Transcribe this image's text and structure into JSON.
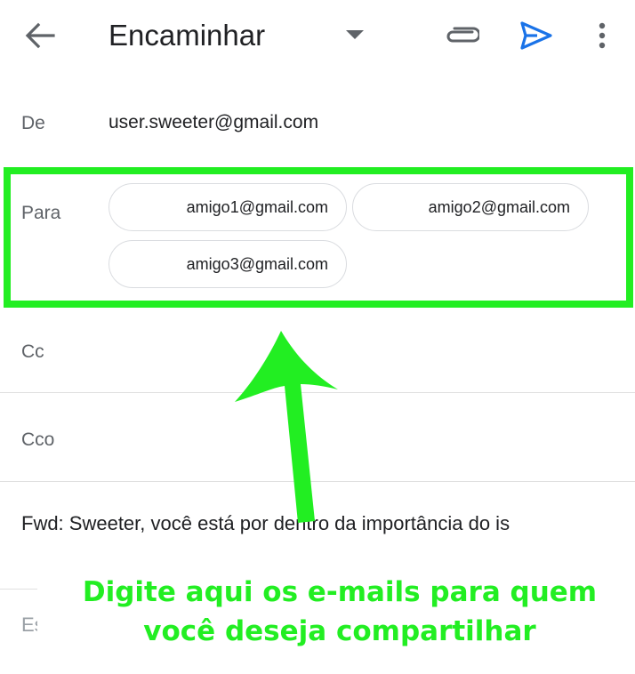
{
  "header": {
    "title": "Encaminhar",
    "icons": [
      "back-arrow-icon",
      "dropdown-icon",
      "attach-icon",
      "send-icon",
      "more-icon"
    ],
    "send_color": "#1a73e8"
  },
  "from": {
    "label": "De",
    "value": "user.sweeter@gmail.com"
  },
  "to": {
    "label": "Para",
    "recipients": [
      "amigo1@gmail.com",
      "amigo2@gmail.com",
      "amigo3@gmail.com"
    ]
  },
  "cc": {
    "label": "Cc"
  },
  "bcc": {
    "label": "Cco"
  },
  "subject": {
    "value": "Fwd: Sweeter, você está por dentro da importância do is"
  },
  "body": {
    "placeholder": "Es"
  },
  "annotation": {
    "text": "Digite aqui os e-mails para quem você deseja compartilhar",
    "color": "#22ee22"
  }
}
